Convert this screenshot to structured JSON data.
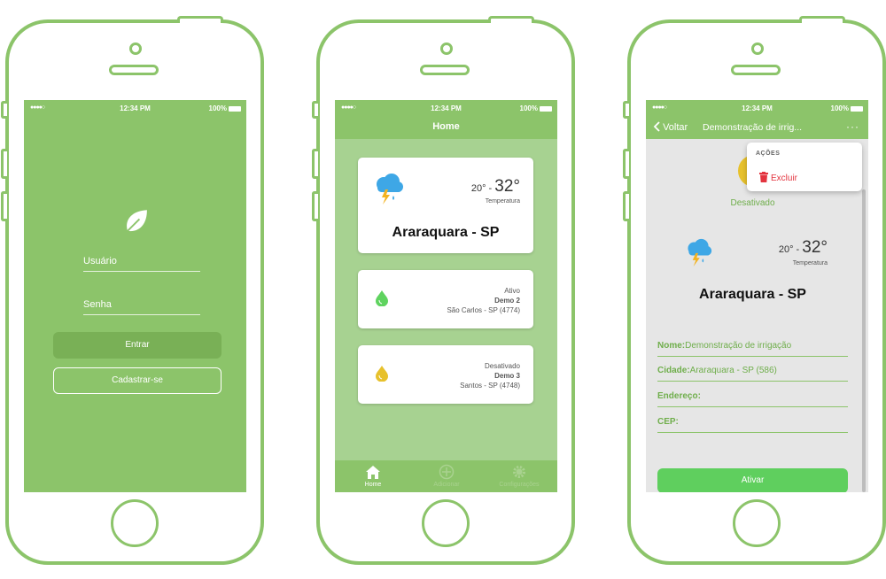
{
  "colors": {
    "brand_green": "#8cc46a",
    "light_green": "#a7d291",
    "danger": "#e3343f",
    "active_drop": "#5fd35f",
    "inactive_drop": "#e7c12c"
  },
  "status_bar": {
    "signal": "●●●●○",
    "time": "12:34 PM",
    "battery": "100%"
  },
  "login": {
    "logo_icon": "leaf-icon",
    "username_placeholder": "Usuário",
    "password_placeholder": "Senha",
    "enter_label": "Entrar",
    "signup_label": "Cadastrar-se"
  },
  "home": {
    "title": "Home",
    "weather": {
      "icon": "storm-cloud-icon",
      "min": "20°",
      "sep": "-",
      "max": "32°",
      "label": "Temperatura",
      "city": "Araraquara - SP"
    },
    "devices": [
      {
        "status": "Ativo",
        "name": "Demo 2",
        "location": "São Carlos - SP (4774)",
        "icon": "water-drop-icon"
      },
      {
        "status": "Desativado",
        "name": "Demo 3",
        "location": "Santos - SP (4748)",
        "icon": "water-drop-icon"
      }
    ],
    "tabs": [
      {
        "label": "Home",
        "icon": "home-icon"
      },
      {
        "label": "Adicionar",
        "icon": "add-icon"
      },
      {
        "label": "Configurações",
        "icon": "gear-icon"
      }
    ]
  },
  "detail": {
    "back_label": "Voltar",
    "title": "Demonstração de irrig...",
    "more_label": "···",
    "actions_header": "AÇÕES",
    "delete_label": "Excluir",
    "status": "Desativado",
    "weather": {
      "min": "20°",
      "sep": "-",
      "max": "32°",
      "label": "Temperatura",
      "city": "Araraquara - SP"
    },
    "fields": [
      {
        "label": "Nome:",
        "value": "Demonstração de irrigação"
      },
      {
        "label": "Cidade:",
        "value": "Araraquara - SP (586)"
      },
      {
        "label": "Endereço:",
        "value": ""
      },
      {
        "label": "CEP:",
        "value": ""
      }
    ],
    "activate_label": "Ativar"
  }
}
